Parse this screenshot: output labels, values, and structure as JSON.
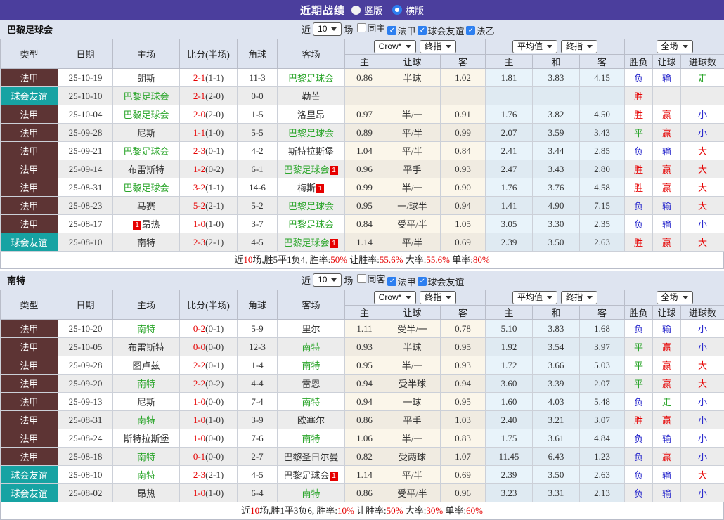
{
  "topbar": {
    "title": "近期战绩",
    "vertical_label": "竖版",
    "horizontal_label": "横版",
    "selected_layout": "横版"
  },
  "table_labels": {
    "type": "类型",
    "date": "日期",
    "home": "主场",
    "score": "比分(半场)",
    "corner": "角球",
    "away": "客场",
    "h": "主",
    "handicap": "让球",
    "a": "客",
    "avg_h": "主",
    "avg_d": "和",
    "avg_a": "客",
    "wdl": "胜负",
    "handicap2": "让球",
    "goals": "进球数"
  },
  "colors": {
    "topbar_purple": "#4b3e9d",
    "league_maroon": "#5d3434",
    "friendly_teal": "#17a3a3",
    "team_green": "#2aa52a",
    "score_red": "#e60000",
    "lose_blue": "#2525cc",
    "checkbox_blue": "#2d7ff0",
    "avg_col_blue": "#e8f3fa",
    "odds_col_cream": "#fbf6ea"
  },
  "sections": [
    {
      "team": "巴黎足球会",
      "near_label": "近",
      "count": "10",
      "games_label": "场",
      "filters": [
        {
          "label": "同主",
          "checked": false
        },
        {
          "label": "法甲",
          "checked": true
        },
        {
          "label": "球会友谊",
          "checked": true
        },
        {
          "label": "法乙",
          "checked": true
        }
      ],
      "selects": {
        "source": "Crow*",
        "source_final": "终指",
        "average": "平均值",
        "average_final": "终指",
        "scope": "全场"
      },
      "rows": [
        {
          "t": "法甲",
          "tc": "l1",
          "d": "25-10-19",
          "h": {
            "n": "朗斯"
          },
          "ft": "2-1",
          "ht": "(1-1)",
          "cr": "11-3",
          "a": {
            "n": "巴黎足球会",
            "g": 1
          },
          "o": [
            "0.86",
            "半球",
            "1.02"
          ],
          "v": [
            "1.81",
            "3.83",
            "4.15"
          ],
          "r": [
            [
              "负",
              "b"
            ],
            [
              "输",
              "b"
            ],
            [
              "走",
              "g"
            ]
          ]
        },
        {
          "t": "球会友谊",
          "tc": "fr",
          "d": "25-10-10",
          "h": {
            "n": "巴黎足球会",
            "g": 1
          },
          "ft": "2-1",
          "ht": "(2-0)",
          "cr": "0-0",
          "a": {
            "n": "勒芒"
          },
          "o": [
            "",
            "",
            ""
          ],
          "v": [
            "",
            "",
            ""
          ],
          "r": [
            [
              "胜",
              "r"
            ],
            [
              "",
              ""
            ],
            [
              "",
              ""
            ]
          ]
        },
        {
          "t": "法甲",
          "tc": "l1",
          "d": "25-10-04",
          "h": {
            "n": "巴黎足球会",
            "g": 1
          },
          "ft": "2-0",
          "ht": "(2-0)",
          "cr": "1-5",
          "a": {
            "n": "洛里昂"
          },
          "o": [
            "0.97",
            "半/一",
            "0.91"
          ],
          "v": [
            "1.76",
            "3.82",
            "4.50"
          ],
          "r": [
            [
              "胜",
              "r"
            ],
            [
              "赢",
              "r"
            ],
            [
              "小",
              "b"
            ]
          ]
        },
        {
          "t": "法甲",
          "tc": "l1",
          "d": "25-09-28",
          "h": {
            "n": "尼斯"
          },
          "ft": "1-1",
          "ht": "(1-0)",
          "cr": "5-5",
          "a": {
            "n": "巴黎足球会",
            "g": 1
          },
          "o": [
            "0.89",
            "平/半",
            "0.99"
          ],
          "v": [
            "2.07",
            "3.59",
            "3.43"
          ],
          "r": [
            [
              "平",
              "g"
            ],
            [
              "赢",
              "r"
            ],
            [
              "小",
              "b"
            ]
          ]
        },
        {
          "t": "法甲",
          "tc": "l1",
          "d": "25-09-21",
          "h": {
            "n": "巴黎足球会",
            "g": 1
          },
          "ft": "2-3",
          "ht": "(0-1)",
          "cr": "4-2",
          "a": {
            "n": "斯特拉斯堡"
          },
          "o": [
            "1.04",
            "平/半",
            "0.84"
          ],
          "v": [
            "2.41",
            "3.44",
            "2.85"
          ],
          "r": [
            [
              "负",
              "b"
            ],
            [
              "输",
              "b"
            ],
            [
              "大",
              "r"
            ]
          ]
        },
        {
          "t": "法甲",
          "tc": "l1",
          "d": "25-09-14",
          "h": {
            "n": "布雷斯特"
          },
          "ft": "1-2",
          "ht": "(0-2)",
          "cr": "6-1",
          "a": {
            "n": "巴黎足球会",
            "g": 1,
            "bd": "1"
          },
          "o": [
            "0.96",
            "平手",
            "0.93"
          ],
          "v": [
            "2.47",
            "3.43",
            "2.80"
          ],
          "r": [
            [
              "胜",
              "r"
            ],
            [
              "赢",
              "r"
            ],
            [
              "大",
              "r"
            ]
          ]
        },
        {
          "t": "法甲",
          "tc": "l1",
          "d": "25-08-31",
          "h": {
            "n": "巴黎足球会",
            "g": 1
          },
          "ft": "3-2",
          "ht": "(1-1)",
          "cr": "14-6",
          "a": {
            "n": "梅斯",
            "bd": "1"
          },
          "o": [
            "0.99",
            "半/一",
            "0.90"
          ],
          "v": [
            "1.76",
            "3.76",
            "4.58"
          ],
          "r": [
            [
              "胜",
              "r"
            ],
            [
              "赢",
              "r"
            ],
            [
              "大",
              "r"
            ]
          ]
        },
        {
          "t": "法甲",
          "tc": "l1",
          "d": "25-08-23",
          "h": {
            "n": "马赛"
          },
          "ft": "5-2",
          "ht": "(2-1)",
          "cr": "5-2",
          "a": {
            "n": "巴黎足球会",
            "g": 1
          },
          "o": [
            "0.95",
            "一/球半",
            "0.94"
          ],
          "v": [
            "1.41",
            "4.90",
            "7.15"
          ],
          "r": [
            [
              "负",
              "b"
            ],
            [
              "输",
              "b"
            ],
            [
              "大",
              "r"
            ]
          ]
        },
        {
          "t": "法甲",
          "tc": "l1",
          "d": "25-08-17",
          "h": {
            "n": "昂热",
            "bd": "1",
            "bp": "pre"
          },
          "ft": "1-0",
          "ht": "(1-0)",
          "cr": "3-7",
          "a": {
            "n": "巴黎足球会",
            "g": 1
          },
          "o": [
            "0.84",
            "受平/半",
            "1.05"
          ],
          "v": [
            "3.05",
            "3.30",
            "2.35"
          ],
          "r": [
            [
              "负",
              "b"
            ],
            [
              "输",
              "b"
            ],
            [
              "小",
              "b"
            ]
          ]
        },
        {
          "t": "球会友谊",
          "tc": "fr",
          "d": "25-08-10",
          "h": {
            "n": "南特"
          },
          "ft": "2-3",
          "ht": "(2-1)",
          "cr": "4-5",
          "a": {
            "n": "巴黎足球会",
            "g": 1,
            "bd": "1"
          },
          "o": [
            "1.14",
            "平/半",
            "0.69"
          ],
          "v": [
            "2.39",
            "3.50",
            "2.63"
          ],
          "r": [
            [
              "胜",
              "r"
            ],
            [
              "赢",
              "r"
            ],
            [
              "大",
              "r"
            ]
          ]
        }
      ],
      "summary": [
        [
          "近",
          false
        ],
        [
          "10",
          true
        ],
        [
          "场,胜5平1负4, 胜率:",
          false
        ],
        [
          "50%",
          true
        ],
        [
          " 让胜率:",
          false
        ],
        [
          "55.6%",
          true
        ],
        [
          " 大率:",
          false
        ],
        [
          "55.6%",
          true
        ],
        [
          " 单率:",
          false
        ],
        [
          "80%",
          true
        ]
      ]
    },
    {
      "team": "南特",
      "near_label": "近",
      "count": "10",
      "games_label": "场",
      "filters": [
        {
          "label": "同客",
          "checked": false
        },
        {
          "label": "法甲",
          "checked": true
        },
        {
          "label": "球会友谊",
          "checked": true
        }
      ],
      "selects": {
        "source": "Crow*",
        "source_final": "终指",
        "average": "平均值",
        "average_final": "终指",
        "scope": "全场"
      },
      "rows": [
        {
          "t": "法甲",
          "tc": "l1",
          "d": "25-10-20",
          "h": {
            "n": "南特",
            "g": 1
          },
          "ft": "0-2",
          "ht": "(0-1)",
          "cr": "5-9",
          "a": {
            "n": "里尔"
          },
          "o": [
            "1.11",
            "受半/一",
            "0.78"
          ],
          "v": [
            "5.10",
            "3.83",
            "1.68"
          ],
          "r": [
            [
              "负",
              "b"
            ],
            [
              "输",
              "b"
            ],
            [
              "小",
              "b"
            ]
          ]
        },
        {
          "t": "法甲",
          "tc": "l1",
          "d": "25-10-05",
          "h": {
            "n": "布雷斯特"
          },
          "ft": "0-0",
          "ht": "(0-0)",
          "cr": "12-3",
          "a": {
            "n": "南特",
            "g": 1
          },
          "o": [
            "0.93",
            "半球",
            "0.95"
          ],
          "v": [
            "1.92",
            "3.54",
            "3.97"
          ],
          "r": [
            [
              "平",
              "g"
            ],
            [
              "赢",
              "r"
            ],
            [
              "小",
              "b"
            ]
          ]
        },
        {
          "t": "法甲",
          "tc": "l1",
          "d": "25-09-28",
          "h": {
            "n": "图卢兹"
          },
          "ft": "2-2",
          "ht": "(0-1)",
          "cr": "1-4",
          "a": {
            "n": "南特",
            "g": 1
          },
          "o": [
            "0.95",
            "半/一",
            "0.93"
          ],
          "v": [
            "1.72",
            "3.66",
            "5.03"
          ],
          "r": [
            [
              "平",
              "g"
            ],
            [
              "赢",
              "r"
            ],
            [
              "大",
              "r"
            ]
          ]
        },
        {
          "t": "法甲",
          "tc": "l1",
          "d": "25-09-20",
          "h": {
            "n": "南特",
            "g": 1
          },
          "ft": "2-2",
          "ht": "(0-2)",
          "cr": "4-4",
          "a": {
            "n": "雷恩"
          },
          "o": [
            "0.94",
            "受半球",
            "0.94"
          ],
          "v": [
            "3.60",
            "3.39",
            "2.07"
          ],
          "r": [
            [
              "平",
              "g"
            ],
            [
              "赢",
              "r"
            ],
            [
              "大",
              "r"
            ]
          ]
        },
        {
          "t": "法甲",
          "tc": "l1",
          "d": "25-09-13",
          "h": {
            "n": "尼斯"
          },
          "ft": "1-0",
          "ht": "(0-0)",
          "cr": "7-4",
          "a": {
            "n": "南特",
            "g": 1
          },
          "o": [
            "0.94",
            "一球",
            "0.95"
          ],
          "v": [
            "1.60",
            "4.03",
            "5.48"
          ],
          "r": [
            [
              "负",
              "b"
            ],
            [
              "走",
              "g"
            ],
            [
              "小",
              "b"
            ]
          ]
        },
        {
          "t": "法甲",
          "tc": "l1",
          "d": "25-08-31",
          "h": {
            "n": "南特",
            "g": 1
          },
          "ft": "1-0",
          "ht": "(1-0)",
          "cr": "3-9",
          "a": {
            "n": "欧塞尔"
          },
          "o": [
            "0.86",
            "平手",
            "1.03"
          ],
          "v": [
            "2.40",
            "3.21",
            "3.07"
          ],
          "r": [
            [
              "胜",
              "r"
            ],
            [
              "赢",
              "r"
            ],
            [
              "小",
              "b"
            ]
          ]
        },
        {
          "t": "法甲",
          "tc": "l1",
          "d": "25-08-24",
          "h": {
            "n": "斯特拉斯堡"
          },
          "ft": "1-0",
          "ht": "(0-0)",
          "cr": "7-6",
          "a": {
            "n": "南特",
            "g": 1
          },
          "o": [
            "1.06",
            "半/一",
            "0.83"
          ],
          "v": [
            "1.75",
            "3.61",
            "4.84"
          ],
          "r": [
            [
              "负",
              "b"
            ],
            [
              "输",
              "b"
            ],
            [
              "小",
              "b"
            ]
          ]
        },
        {
          "t": "法甲",
          "tc": "l1",
          "d": "25-08-18",
          "h": {
            "n": "南特",
            "g": 1
          },
          "ft": "0-1",
          "ht": "(0-0)",
          "cr": "2-7",
          "a": {
            "n": "巴黎圣日尔曼"
          },
          "o": [
            "0.82",
            "受两球",
            "1.07"
          ],
          "v": [
            "11.45",
            "6.43",
            "1.23"
          ],
          "r": [
            [
              "负",
              "b"
            ],
            [
              "赢",
              "r"
            ],
            [
              "小",
              "b"
            ]
          ]
        },
        {
          "t": "球会友谊",
          "tc": "fr",
          "d": "25-08-10",
          "h": {
            "n": "南特",
            "g": 1
          },
          "ft": "2-3",
          "ht": "(2-1)",
          "cr": "4-5",
          "a": {
            "n": "巴黎足球会",
            "bd": "1"
          },
          "o": [
            "1.14",
            "平/半",
            "0.69"
          ],
          "v": [
            "2.39",
            "3.50",
            "2.63"
          ],
          "r": [
            [
              "负",
              "b"
            ],
            [
              "输",
              "b"
            ],
            [
              "大",
              "r"
            ]
          ]
        },
        {
          "t": "球会友谊",
          "tc": "fr",
          "d": "25-08-02",
          "h": {
            "n": "昂热"
          },
          "ft": "1-0",
          "ht": "(1-0)",
          "cr": "6-4",
          "a": {
            "n": "南特",
            "g": 1
          },
          "o": [
            "0.86",
            "受平/半",
            "0.96"
          ],
          "v": [
            "3.23",
            "3.31",
            "2.13"
          ],
          "r": [
            [
              "负",
              "b"
            ],
            [
              "输",
              "b"
            ],
            [
              "小",
              "b"
            ]
          ]
        }
      ],
      "summary": [
        [
          "近",
          false
        ],
        [
          "10",
          true
        ],
        [
          "场,胜1平3负6, 胜率:",
          false
        ],
        [
          "10%",
          true
        ],
        [
          " 让胜率:",
          false
        ],
        [
          "50%",
          true
        ],
        [
          " 大率:",
          false
        ],
        [
          "30%",
          true
        ],
        [
          " 单率:",
          false
        ],
        [
          "60%",
          true
        ]
      ]
    }
  ]
}
